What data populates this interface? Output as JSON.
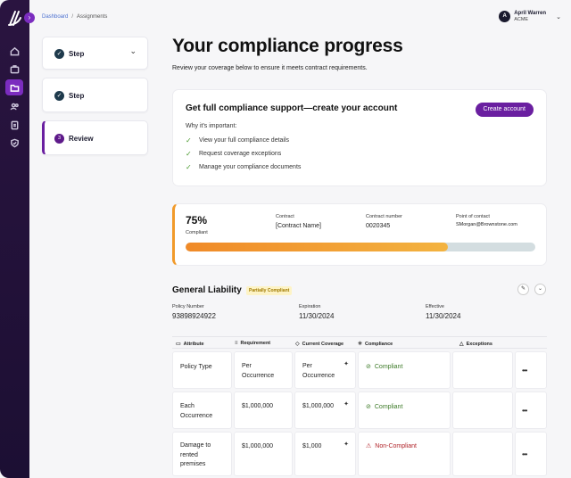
{
  "breadcrumb": {
    "parent": "Dashboard",
    "current": "Assignments"
  },
  "user": {
    "initial": "A",
    "name": "April Warren",
    "org": "ACME"
  },
  "steps": [
    {
      "label": "Step",
      "status": "complete"
    },
    {
      "label": "Step",
      "status": "complete"
    },
    {
      "label": "Review",
      "number": "3",
      "status": "active"
    }
  ],
  "page": {
    "title": "Your compliance progress",
    "subtitle": "Review your coverage below to ensure it meets contract requirements."
  },
  "cta": {
    "title": "Get full compliance support—create your account",
    "button": "Create account",
    "why": "Why it's important:",
    "benefits": [
      "View your full compliance details",
      "Request coverage exceptions",
      "Manage your compliance documents"
    ]
  },
  "progress": {
    "percent_text": "75%",
    "percent_label": "Compliant",
    "percent_value": 75,
    "contract_label": "Contract",
    "contract_value": "[Contract Name]",
    "number_label": "Contract number",
    "number_value": "0020345",
    "poc_label": "Point of contact",
    "poc_value": "SMorgan@Brownstone.com"
  },
  "policy": {
    "title": "General Liability",
    "badge": "Partially Compliant",
    "number_label": "Policy Number",
    "number_value": "93898924922",
    "expiration_label": "Expiration",
    "expiration_value": "11/30/2024",
    "effective_label": "Effective",
    "effective_value": "11/30/2024"
  },
  "table": {
    "headers": [
      "Attribute",
      "Requirement",
      "Current Coverage",
      "Compliance",
      "Exceptions"
    ],
    "rows": [
      {
        "attribute": "Policy Type",
        "requirement": "Per\nOccurrence",
        "coverage": "Per\nOccurrence",
        "compliance": "Compliant",
        "status": "ok"
      },
      {
        "attribute": "Each\nOccurrence",
        "requirement": "$1,000,000",
        "coverage": "$1,000,000",
        "compliance": "Compliant",
        "status": "ok"
      },
      {
        "attribute": "Damage to\nrented\npremises",
        "requirement": "$1,000,000",
        "coverage": "$1,000",
        "compliance": "Non-Compliant",
        "status": "bad"
      }
    ]
  },
  "colors": {
    "brand": "#6a1fa0",
    "sidebar": "#1c0f33",
    "progress": "#f19a2a",
    "ok": "#3c7a27",
    "bad": "#b1242a"
  }
}
